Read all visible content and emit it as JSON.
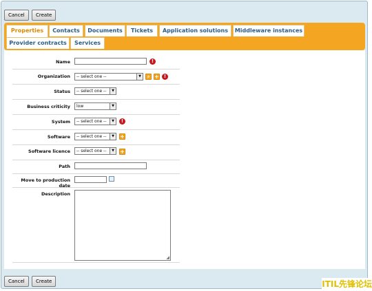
{
  "toolbar_top": {
    "cancel": "Cancel",
    "create": "Create"
  },
  "toolbar_bottom": {
    "cancel": "Cancel",
    "create": "Create"
  },
  "tabs": [
    {
      "label": "Properties",
      "active": true
    },
    {
      "label": "Contacts"
    },
    {
      "label": "Documents"
    },
    {
      "label": "Tickets"
    },
    {
      "label": "Application solutions"
    },
    {
      "label": "Middleware instances"
    },
    {
      "label": "Provider contracts"
    },
    {
      "label": "Services"
    }
  ],
  "form": {
    "name": {
      "label": "Name",
      "value": ""
    },
    "organization": {
      "label": "Organization",
      "value": "-- select one --"
    },
    "status": {
      "label": "Status",
      "value": "-- select one --"
    },
    "business_criticity": {
      "label": "Business criticity",
      "value": "low"
    },
    "system": {
      "label": "System",
      "value": "-- select one --"
    },
    "software": {
      "label": "Software",
      "value": "-- select one --"
    },
    "software_licence": {
      "label": "Software licence",
      "value": "-- select one --"
    },
    "path": {
      "label": "Path",
      "value": ""
    },
    "move_to_production_date": {
      "label": "Move to production date",
      "value": ""
    },
    "description": {
      "label": "Description",
      "value": ""
    }
  },
  "icons": {
    "mandatory": "exclamation-icon",
    "add": "plus-icon",
    "search": "magnifier-icon",
    "calendar": "calendar-icon"
  },
  "watermark": "ITIL先锋论坛",
  "colors": {
    "tab_bar": "#f4a623",
    "tab_text": "#2a5d86",
    "active_tab_text": "#e08a00",
    "mandatory": "#c8181e",
    "frame_bg": "#dbe9f1"
  }
}
